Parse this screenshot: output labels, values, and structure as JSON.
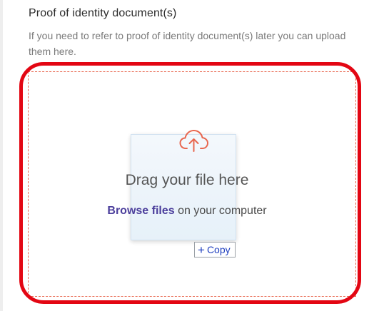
{
  "section": {
    "title": "Proof of identity document(s)",
    "help": "If you need to refer to proof of identity document(s) later you can upload them here."
  },
  "dropzone": {
    "title": "Drag your file here",
    "browse_link": "Browse files",
    "browse_suffix": " on your computer",
    "icon": "cloud-upload-icon"
  },
  "drag_feedback": {
    "copy_label": "Copy",
    "icon": "plus-icon"
  },
  "colors": {
    "dashed_border": "#e8674f",
    "highlight": "#e30613",
    "link": "#4c3f9c",
    "copy_text": "#1f3fbf"
  }
}
